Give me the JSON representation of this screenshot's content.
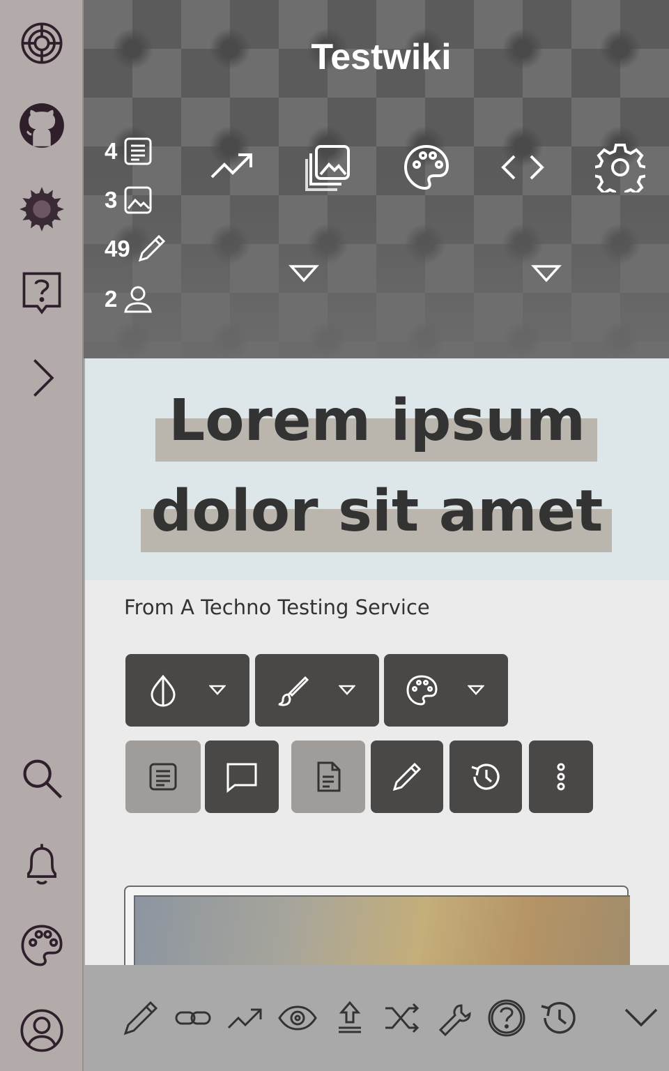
{
  "site": {
    "title": "Testwiki"
  },
  "sidebar": {
    "items": [
      {
        "icon": "lifebuoy-icon"
      },
      {
        "icon": "github-icon"
      },
      {
        "icon": "sunflower-icon"
      },
      {
        "icon": "help-bubble-icon"
      },
      {
        "icon": "chevron-right-icon"
      },
      {
        "icon": "search-icon"
      },
      {
        "icon": "bell-icon"
      },
      {
        "icon": "palette-icon"
      },
      {
        "icon": "user-circle-icon"
      }
    ]
  },
  "stats": {
    "pages": "4",
    "images": "3",
    "edits": "49",
    "users": "2"
  },
  "header_icons": [
    "trending-icon",
    "images-icon",
    "palette-icon",
    "code-icon",
    "gear-icon"
  ],
  "page": {
    "title_line1": "Lorem ipsum",
    "title_line2": "dolor sit amet",
    "from": "From A Techno Testing Service"
  },
  "buttons_row1": [
    "contrast-icon",
    "brush-icon",
    "palette-icon"
  ],
  "buttons_row2": [
    "article-icon",
    "comment-icon",
    "document-icon",
    "pencil-icon",
    "history-icon",
    "more-vertical-icon"
  ],
  "toolbar": [
    "pencil-icon",
    "link-icon",
    "trending-icon",
    "eye-icon",
    "upload-icon",
    "shuffle-icon",
    "wrench-icon",
    "help-icon",
    "history-icon",
    "chevron-down-icon"
  ],
  "colors": {
    "sidebar_bg": "#b3aaaa",
    "sidebar_icon": "#2f1f2b",
    "button_dark": "#4a4847",
    "button_light": "#a09c99",
    "title_highlight": "#bab6ae",
    "title_block_bg": "#dde6e9"
  }
}
